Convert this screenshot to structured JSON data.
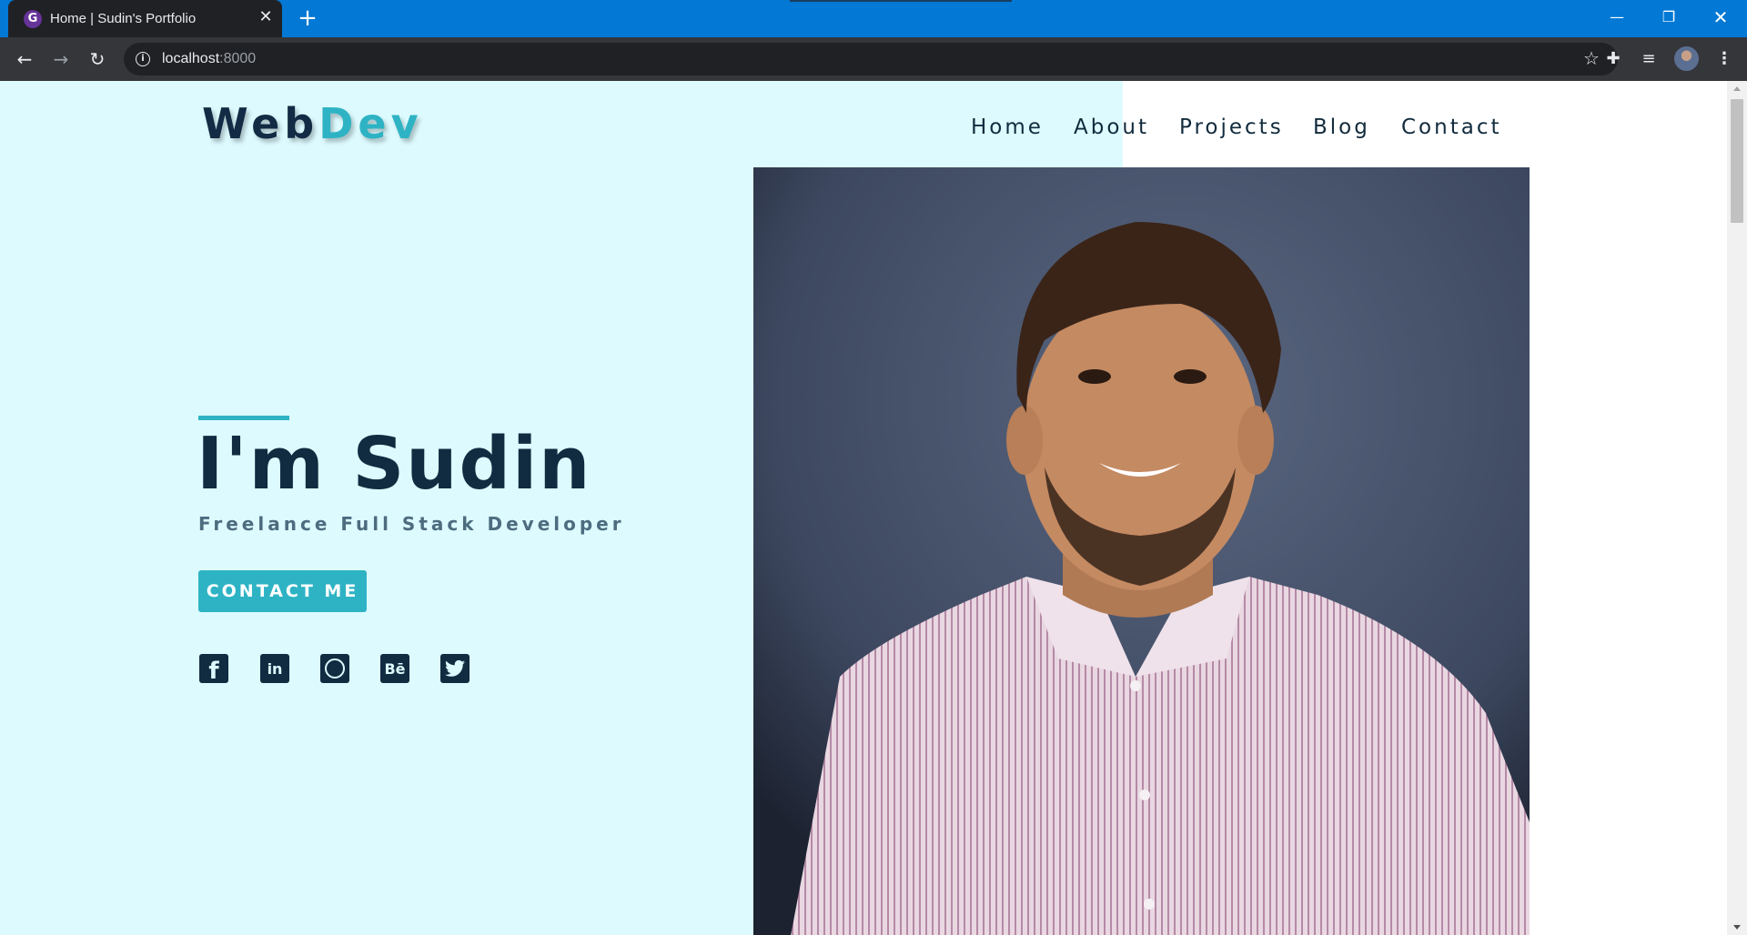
{
  "browser": {
    "tab_title": "Home | Sudin's Portfolio",
    "tab_favicon": "G",
    "tab_close_glyph": "✕",
    "new_tab_glyph": "+",
    "url_host": "localhost",
    "url_port": ":8000",
    "window_controls": {
      "minimize": "—",
      "maximize": "❐",
      "close": "✕"
    },
    "nav_glyphs": {
      "back": "←",
      "forward": "→",
      "reload": "↻",
      "info": "i",
      "star": "☆",
      "extensions": "✚",
      "media": "≡",
      "menu": "⋮"
    }
  },
  "site": {
    "logo": {
      "part1": "Web",
      "part2": "Dev"
    },
    "nav": [
      "Home",
      "About",
      "Projects",
      "Blog",
      "Contact"
    ],
    "hero": {
      "title": "I'm Sudin",
      "subtitle": "Freelance Full Stack Developer",
      "cta": "CONTACT ME"
    },
    "social": [
      {
        "icon": "facebook-icon",
        "glyph": "f"
      },
      {
        "icon": "linkedin-icon",
        "glyph": "in"
      },
      {
        "icon": "dribbble-icon"
      },
      {
        "icon": "behance-icon",
        "glyph": "Bē"
      },
      {
        "icon": "twitter-icon"
      }
    ],
    "portrait": "portrait-photo"
  },
  "colors": {
    "chrome_titlebar": "#0378d4",
    "chrome_toolbar": "#35363a",
    "hero_bg": "#ddfbff",
    "accent": "#2eb3c4",
    "navy": "#112b40"
  }
}
